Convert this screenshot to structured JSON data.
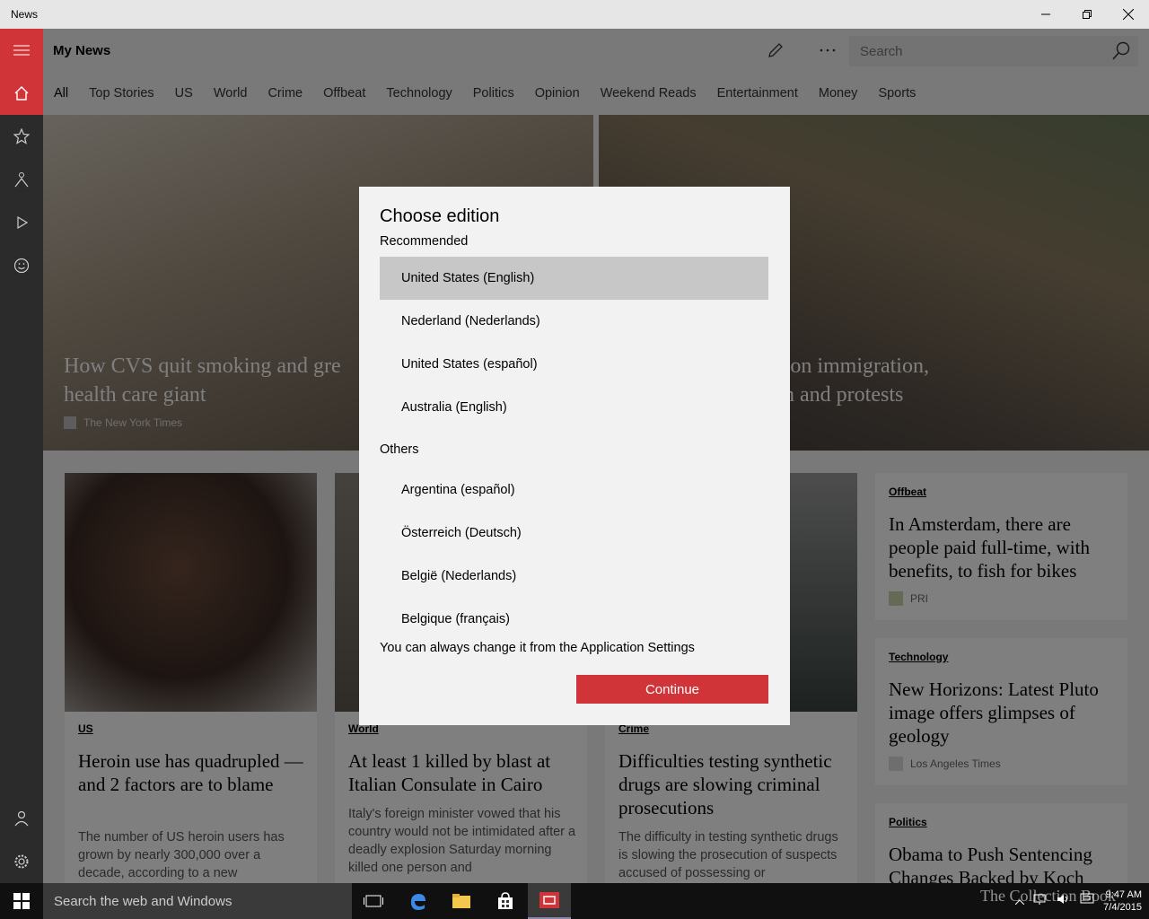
{
  "window": {
    "title": "News"
  },
  "header": {
    "title": "My News",
    "search_placeholder": "Search"
  },
  "tabs": [
    {
      "label": "All"
    },
    {
      "label": "Top Stories"
    },
    {
      "label": "US"
    },
    {
      "label": "World"
    },
    {
      "label": "Crime"
    },
    {
      "label": "Offbeat"
    },
    {
      "label": "Technology"
    },
    {
      "label": "Politics"
    },
    {
      "label": "Opinion"
    },
    {
      "label": "Weekend Reads"
    },
    {
      "label": "Entertainment"
    },
    {
      "label": "Money"
    },
    {
      "label": "Sports"
    }
  ],
  "hero": {
    "left": {
      "headline_1": "How CVS quit smoking and gre",
      "headline_2": "health care giant",
      "source": "The New York Times"
    },
    "right": {
      "headline_1": "te on immigration,",
      "headline_2": "sm and protests"
    }
  },
  "cards": [
    {
      "category": "US",
      "headline": "Heroin use has quadrupled — and 2 factors are to blame",
      "desc": "The number of US heroin users has grown by nearly 300,000 over a decade, according to a new"
    },
    {
      "category": "World",
      "headline": "At least 1 killed by blast at Italian Consulate in Cairo",
      "desc": "Italy's foreign minister vowed that his country would not be intimidated after a deadly explosion Saturday morning killed one person and"
    },
    {
      "category": "Crime",
      "headline": "Difficulties testing synthetic drugs are slowing criminal prosecutions",
      "desc": "The difficulty in testing synthetic drugs is slowing the prosecution of suspects accused of possessing or"
    }
  ],
  "side_cards": [
    {
      "category": "Offbeat",
      "headline": "In Amsterdam, there are people paid full-time, with benefits, to fish for bikes",
      "source": "PRI"
    },
    {
      "category": "Technology",
      "headline": "New Horizons: Latest Pluto image offers glimpses of geology",
      "source": "Los Angeles Times"
    },
    {
      "category": "Politics",
      "headline": "Obama to Push Sentencing Changes Backed by Koch"
    }
  ],
  "dialog": {
    "title": "Choose edition",
    "recommended_label": "Recommended",
    "recommended": [
      {
        "label": "United States (English)"
      },
      {
        "label": "Nederland (Nederlands)"
      },
      {
        "label": "United States (español)"
      },
      {
        "label": "Australia (English)"
      }
    ],
    "others_label": "Others",
    "others": [
      {
        "label": "Argentina (español)"
      },
      {
        "label": "Österreich (Deutsch)"
      },
      {
        "label": "België (Nederlands)"
      },
      {
        "label": "Belgique (français)"
      }
    ],
    "note": "You can always change it from the Application Settings",
    "continue_label": "Continue"
  },
  "taskbar": {
    "search_text": "Search the web and Windows",
    "time": "9:47 AM",
    "date": "7/4/2015",
    "watermark": "The Collection Book"
  },
  "colors": {
    "accent": "#d13438",
    "rail": "#2b2b2b",
    "taskbar": "#101010"
  }
}
